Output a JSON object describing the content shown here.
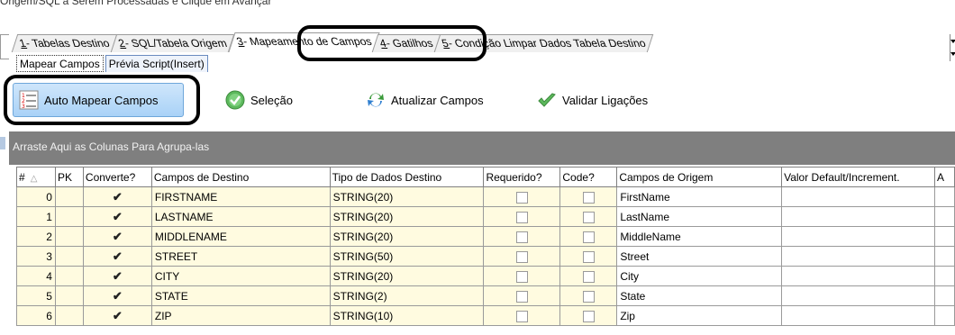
{
  "instruction": "Origem/SQL a Serem Processadas e Clique em Avançar",
  "main_tabs": [
    {
      "num": "1",
      "label": " - Tabelas Destino"
    },
    {
      "num": "2",
      "label": " - SQL/Tabela Origem"
    },
    {
      "num": "3",
      "label": " - Mapeamento de Campos"
    },
    {
      "num": "4",
      "label": " - Gatilhos"
    },
    {
      "num": "5",
      "label": " - Condição Limpar Dados Tabela Destino"
    }
  ],
  "sub_tabs": [
    {
      "label": "Mapear Campos"
    },
    {
      "label": "Prévia Script(Insert)"
    }
  ],
  "toolbar": {
    "auto_map": "Auto Mapear Campos",
    "selection": "Seleção",
    "update_fields": "Atualizar Campos",
    "validate_links": "Validar Ligações"
  },
  "group_hint": "Arraste Aqui as Colunas Para Agrupa-las",
  "columns": [
    "#",
    "PK",
    "Converte?",
    "Campos de Destino",
    "Tipo de Dados Destino",
    "Requerido?",
    "Code?",
    "Campos de Origem",
    "Valor Default/Increment.",
    "A"
  ],
  "rows": [
    {
      "n": "0",
      "dest": "FIRSTNAME",
      "type": "STRING(20)",
      "src": "FirstName"
    },
    {
      "n": "1",
      "dest": "LASTNAME",
      "type": "STRING(20)",
      "src": "LastName"
    },
    {
      "n": "2",
      "dest": "MIDDLENAME",
      "type": "STRING(20)",
      "src": "MiddleName"
    },
    {
      "n": "3",
      "dest": "STREET",
      "type": "STRING(50)",
      "src": "Street"
    },
    {
      "n": "4",
      "dest": "CITY",
      "type": "STRING(20)",
      "src": "City"
    },
    {
      "n": "5",
      "dest": "STATE",
      "type": "STRING(2)",
      "src": "State"
    },
    {
      "n": "6",
      "dest": "ZIP",
      "type": "STRING(10)",
      "src": "Zip"
    }
  ],
  "check_mark": "✔",
  "colors": {
    "grid_yellow": "#fffbe0",
    "group_bar": "#7f7f7f",
    "button_blue": "#a9d2f7"
  }
}
